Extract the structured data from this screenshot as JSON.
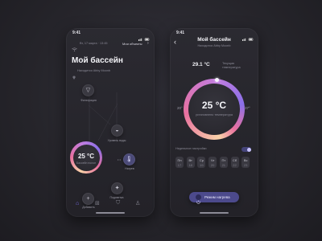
{
  "colors": {
    "accent": "#6b5fcf",
    "gradient_pink": "#e8709f",
    "gradient_lilac": "#c07de0",
    "background": "#26252b"
  },
  "screen1": {
    "status_time": "9:41",
    "header_date": "Вт, 17 марта · 13:45",
    "header_link": "Мои объекты",
    "title": "Мой бассейн",
    "subtitle": "Находится Abby Moonb",
    "devices": [
      {
        "label": "Фильтрация",
        "icon": "filter-icon"
      },
      {
        "label": "Уровень воды",
        "icon": "water-level-icon"
      },
      {
        "label": "Нагрев",
        "icon": "heating-icon"
      },
      {
        "label": "Подсветка",
        "icon": "light-icon"
      },
      {
        "label": "Добавить",
        "icon": "plus-icon"
      }
    ],
    "dial_temp": "25 °C",
    "dial_caption": "Бассейн полон",
    "nav": [
      "home-icon",
      "grid-icon",
      "cart-icon",
      "profile-icon"
    ]
  },
  "screen2": {
    "status_time": "9:41",
    "title": "Мой бассейн",
    "subtitle": "Находится Abby Moonb",
    "current_temp": "29.1 °C",
    "current_caption": "Текущая температура",
    "dial_temp": "25 °C",
    "dial_caption": "установлено температура",
    "min_label": "20°",
    "max_label": "37°",
    "schedule_label": "Недельное настройки",
    "days": [
      {
        "name": "Пн",
        "num": "17"
      },
      {
        "name": "Вт",
        "num": "18"
      },
      {
        "name": "Ср",
        "num": "19"
      },
      {
        "name": "Чт",
        "num": "20"
      },
      {
        "name": "Пт",
        "num": "21"
      },
      {
        "name": "Сб",
        "num": "22"
      },
      {
        "name": "Вс",
        "num": "23"
      }
    ],
    "mode_button": "Режим нагрева"
  }
}
